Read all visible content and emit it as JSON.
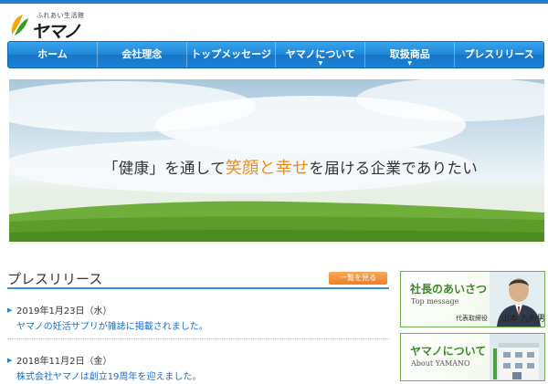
{
  "logo": {
    "tagline": "ふれあい生活館",
    "name": "ヤマノ"
  },
  "nav": {
    "items": [
      {
        "label": "ホーム"
      },
      {
        "label": "会社理念"
      },
      {
        "label": "トップメッセージ"
      },
      {
        "label": "ヤマノについて",
        "caret": "▼"
      },
      {
        "label": "取扱商品",
        "caret": "▼"
      },
      {
        "label": "プレスリリース"
      }
    ]
  },
  "hero": {
    "text_before": "「健康」を通して",
    "text_accent": "笑顔と幸せ",
    "text_after": "を届ける企業でありたい"
  },
  "press": {
    "title": "プレスリリース",
    "more_label": "一覧を見る",
    "items": [
      {
        "date": "2019年1月23日（水）",
        "text": "ヤマノの妊活サプリが雑誌に掲載されました。"
      },
      {
        "date": "2018年11月2日（金）",
        "text": "株式会社ヤマノは創立19周年を迎えました。"
      }
    ]
  },
  "sidebar": {
    "greeting": {
      "title": "社長のあいさつ",
      "subtitle": "Top message",
      "role": "代表取締役",
      "name": "山本 九州男"
    },
    "about": {
      "title": "ヤマノについて",
      "subtitle": "About YAMANO"
    }
  },
  "colors": {
    "nav_blue": "#1c86d8",
    "accent_orange": "#f08a13",
    "card_green": "#3a8a24"
  }
}
